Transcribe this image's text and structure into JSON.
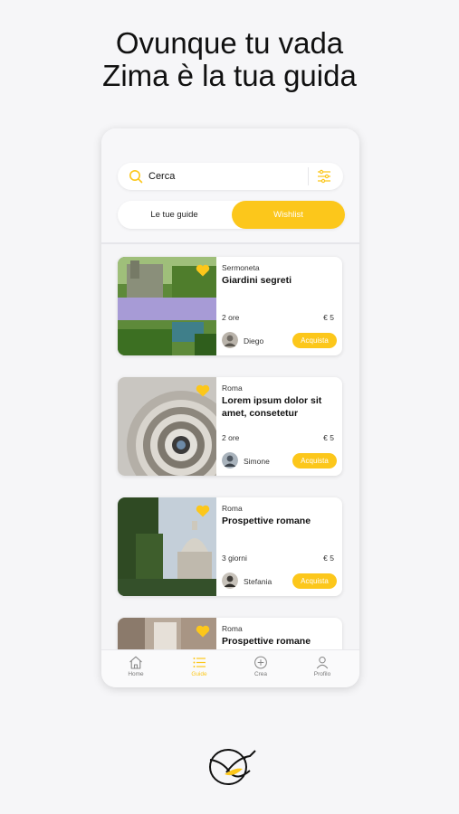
{
  "headline": {
    "line1": "Ovunque tu vada",
    "line2": "Zima è la tua guida"
  },
  "search": {
    "placeholder": "Cerca"
  },
  "tabs": [
    {
      "label": "Le tue guide",
      "active": false
    },
    {
      "label": "Wishlist",
      "active": true
    }
  ],
  "cards": [
    {
      "city": "Sermoneta",
      "title": "Giardini segreti",
      "duration": "2 ore",
      "price": "€ 5",
      "author": "Diego",
      "button": "Acquista"
    },
    {
      "city": "Roma",
      "title": "Lorem ipsum dolor sit amet, consetetur",
      "duration": "2 ore",
      "price": "€ 5",
      "author": "Simone",
      "button": "Acquista"
    },
    {
      "city": "Roma",
      "title": "Prospettive romane",
      "duration": "3 giorni",
      "price": "€ 5",
      "author": "Stefania",
      "button": "Acquista"
    },
    {
      "city": "Roma",
      "title": "Prospettive romane"
    }
  ],
  "tabbar": [
    {
      "label": "Home",
      "icon": "home-icon",
      "active": false
    },
    {
      "label": "Guide",
      "icon": "list-icon",
      "active": true
    },
    {
      "label": "Crea",
      "icon": "plus-circle-icon",
      "active": false
    },
    {
      "label": "Profilo",
      "icon": "user-icon",
      "active": false
    }
  ],
  "colors": {
    "accent": "#fcc71b",
    "background": "#f6f6f8"
  },
  "brand": {
    "logo_icon": "hummingbird-logo-icon"
  }
}
